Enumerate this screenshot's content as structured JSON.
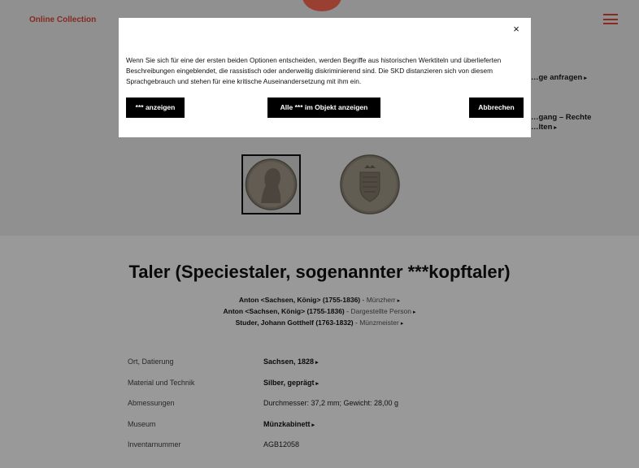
{
  "header": {
    "logo": "Online Collection",
    "menu_icon": "hamburger-menu-icon",
    "brand_color": "#e0463a"
  },
  "side_links": {
    "request": "…ge anfragen",
    "access_rights_line1": "…gang – Rechte",
    "access_rights_line2": "…lten"
  },
  "thumbnails": [
    "coin-obverse",
    "coin-reverse"
  ],
  "object": {
    "title": "Taler (Speciestaler, sogenannter ***kopftaler)",
    "persons": [
      {
        "name": "Anton <Sachsen, König> (1755-1836)",
        "role": "Münzherr"
      },
      {
        "name": "Anton <Sachsen, König> (1755-1836)",
        "role": "Dargestellte Person"
      },
      {
        "name": "Studer, Johann Gotthelf (1763-1832)",
        "role": "Münzmeister"
      }
    ],
    "details": [
      {
        "label": "Ort, Datierung",
        "value": "Sachsen, 1828",
        "link": true
      },
      {
        "label": "Material und Technik",
        "value": "Silber, geprägt",
        "link": true
      },
      {
        "label": "Abmessungen",
        "value": "Durchmesser: 37,2 mm; Gewicht: 28,00 g",
        "link": false
      },
      {
        "label": "Museum",
        "value": "Münzkabinett",
        "link": true
      },
      {
        "label": "Inventarnummer",
        "value": "AGB12058",
        "link": false
      }
    ]
  },
  "modal": {
    "close_label": "×",
    "text": "Wenn Sie sich für eine der ersten beiden Optionen entscheiden, werden Begriffe aus historischen Werktiteln und überlieferten Beschreibungen eingeblendet, die rassistisch oder anderweitig diskriminierend sind. Die SKD distanzieren sich von diesem Sprachgebrauch und stehen für eine kritische Auseinandersetzung mit ihm ein.",
    "btn_show": "*** anzeigen",
    "btn_show_all": "Alle *** im Objekt anzeigen",
    "btn_cancel": "Abbrechen"
  }
}
